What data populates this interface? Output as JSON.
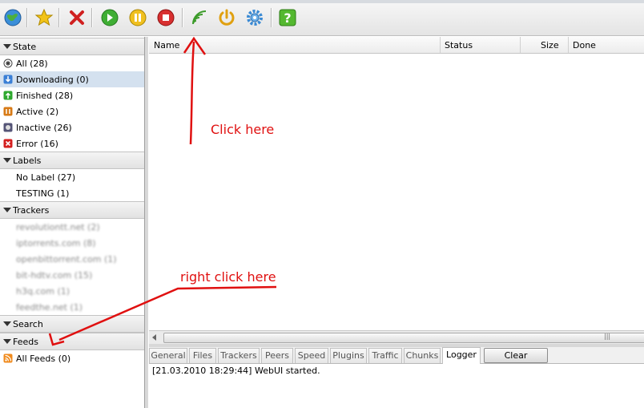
{
  "toolbar": {
    "icons": [
      "globe-icon",
      "star-icon",
      "remove-icon",
      "start-icon",
      "pause-icon",
      "stop-icon",
      "rss-feed-icon",
      "power-icon",
      "settings-icon",
      "help-icon"
    ]
  },
  "sidebar": {
    "state_label": "State",
    "state_items": [
      {
        "label": "All (28)",
        "icon": "all-icon",
        "color": "#444444"
      },
      {
        "label": "Downloading (0)",
        "icon": "download-icon",
        "color": "#3a7fd6"
      },
      {
        "label": "Finished (28)",
        "icon": "finished-icon",
        "color": "#2ea82e"
      },
      {
        "label": "Active (2)",
        "icon": "active-icon",
        "color": "#d77a16"
      },
      {
        "label": "Inactive (26)",
        "icon": "inactive-icon",
        "color": "#555577"
      },
      {
        "label": "Error (16)",
        "icon": "error-icon",
        "color": "#d42020"
      }
    ],
    "labels_label": "Labels",
    "label_items": [
      "No Label (27)",
      "TESTING (1)"
    ],
    "trackers_label": "Trackers",
    "tracker_items": [
      "revolutiontt.net (2)",
      "iptorrents.com (8)",
      "openbittorrent.com (1)",
      "bit-hdtv.com (15)",
      "h3q.com (1)",
      "feedthe.net (1)"
    ],
    "search_label": "Search",
    "feeds_label": "Feeds",
    "feed_items": [
      "All Feeds (0)"
    ]
  },
  "list": {
    "columns": [
      "Name",
      "Status",
      "Size",
      "Done"
    ]
  },
  "tabs": {
    "items": [
      "General",
      "Files",
      "Trackers",
      "Peers",
      "Speed",
      "Plugins",
      "Traffic",
      "Chunks",
      "Logger"
    ],
    "active": "Logger",
    "clear_label": "Clear"
  },
  "log": {
    "line": "[21.03.2010 18:29:44] WebUI started."
  },
  "annotations": {
    "click_here": "Click here",
    "right_click_here": "right click here",
    "color": "#e01010"
  }
}
